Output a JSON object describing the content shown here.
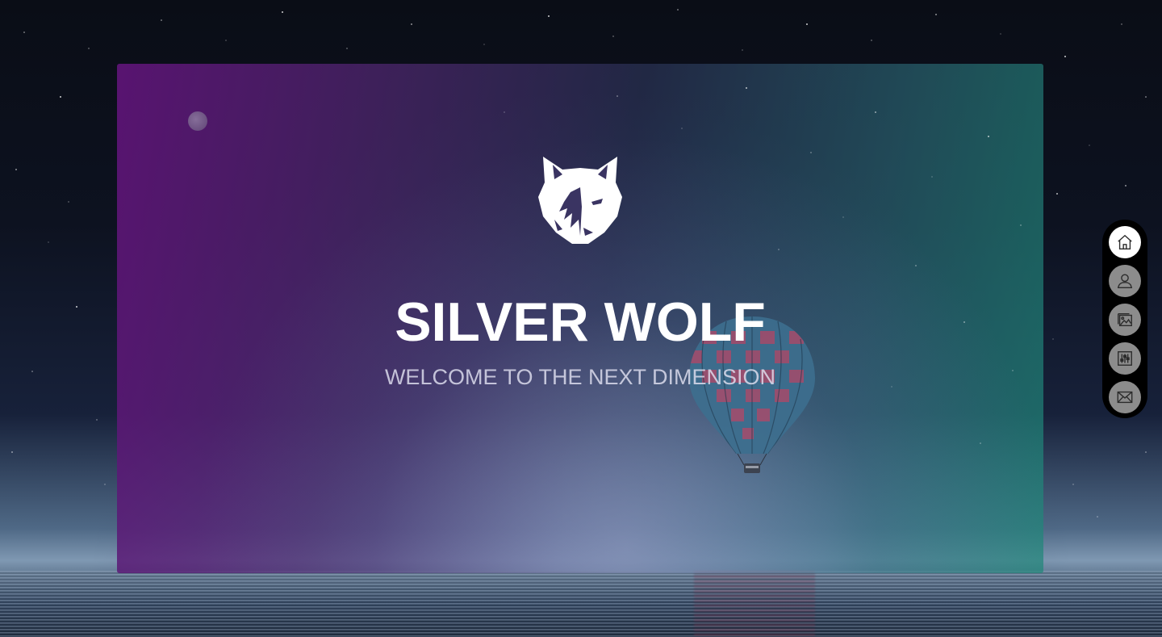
{
  "hero": {
    "title": "SILVER WOLF",
    "subtitle": "WELCOME TO THE NEXT DIMENSION"
  },
  "nav": {
    "items": [
      {
        "icon": "home-icon",
        "active": true
      },
      {
        "icon": "user-icon",
        "active": false
      },
      {
        "icon": "gallery-icon",
        "active": false
      },
      {
        "icon": "sliders-icon",
        "active": false
      },
      {
        "icon": "mail-icon",
        "active": false
      }
    ]
  },
  "colors": {
    "gradient_left": "#5f1478",
    "gradient_right": "#1e8778",
    "nav_background": "#000000",
    "nav_active": "#ffffff",
    "nav_inactive": "#8c8c8c"
  }
}
